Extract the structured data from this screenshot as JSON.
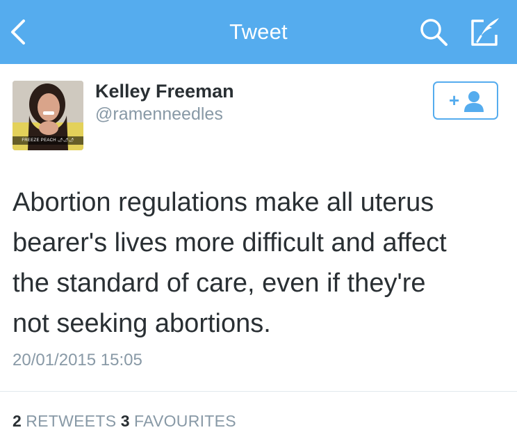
{
  "nav": {
    "title": "Tweet",
    "icons": [
      "back-icon",
      "search-icon",
      "compose-icon"
    ]
  },
  "user": {
    "name": "Kelley Freeman",
    "handle": "@ramenneedles",
    "avatar_caption": "FREEZE PEACH 🌶🌶🌶"
  },
  "tweet": {
    "lines": [
      "Abortion regulations make all uterus",
      "bearer's lives more difficult and affect",
      "the standard of care, even if they're",
      "not seeking abortions."
    ],
    "timestamp": "20/01/2015 15:05"
  },
  "stats": {
    "retweets_count": "2",
    "retweets_label": "RETWEETS",
    "favourites_count": "3",
    "favourites_label": "FAVOURITES"
  },
  "colors": {
    "brand": "#55acee",
    "text": "#292f33",
    "muted": "#8899a6"
  }
}
